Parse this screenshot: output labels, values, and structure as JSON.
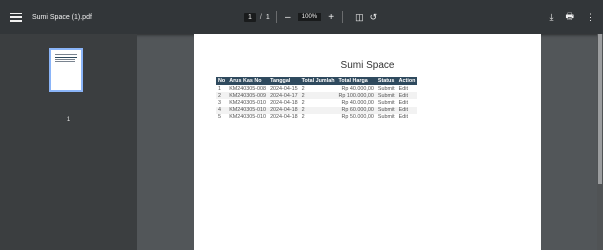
{
  "toolbar": {
    "title": "Sumi Space (1).pdf",
    "page_current": "1",
    "page_sep": "/",
    "page_total": "1",
    "zoom_out": "–",
    "zoom_level": "100%",
    "zoom_in": "+",
    "fit_icon_glyph": "◫",
    "rotate_icon_glyph": "↺",
    "download_icon_glyph": "⤓",
    "print_icon_glyph": "🖶",
    "more_icon_glyph": "⋮"
  },
  "sidebar": {
    "thumbnail_number": "1"
  },
  "document": {
    "title": "Sumi Space",
    "columns": [
      "No",
      "Arus Kas No",
      "Tanggal",
      "Total Jumlah",
      "Total Harga",
      "Status",
      "Action"
    ],
    "rows": [
      [
        "1",
        "KM240305-008",
        "2024-04-15",
        "2",
        "Rp 40.000,00",
        "Submit",
        "Edit"
      ],
      [
        "2",
        "KM240305-009",
        "2024-04-17",
        "2",
        "Rp 100.000,00",
        "Submit",
        "Edit"
      ],
      [
        "3",
        "KM240305-010",
        "2024-04-18",
        "2",
        "Rp 40.000,00",
        "Submit",
        "Edit"
      ],
      [
        "4",
        "KM240305-010",
        "2024-04-18",
        "2",
        "Rp 60.000,00",
        "Submit",
        "Edit"
      ],
      [
        "5",
        "KM240305-010",
        "2024-04-18",
        "2",
        "Rp 50.000,00",
        "Submit",
        "Edit"
      ]
    ]
  },
  "colors": {
    "toolbar_bg": "#323639",
    "viewer_bg": "#525659",
    "sidebar_bg": "#3b3e40",
    "table_header_bg": "#2f4a5e",
    "thumbnail_border": "#8ab4f8"
  }
}
